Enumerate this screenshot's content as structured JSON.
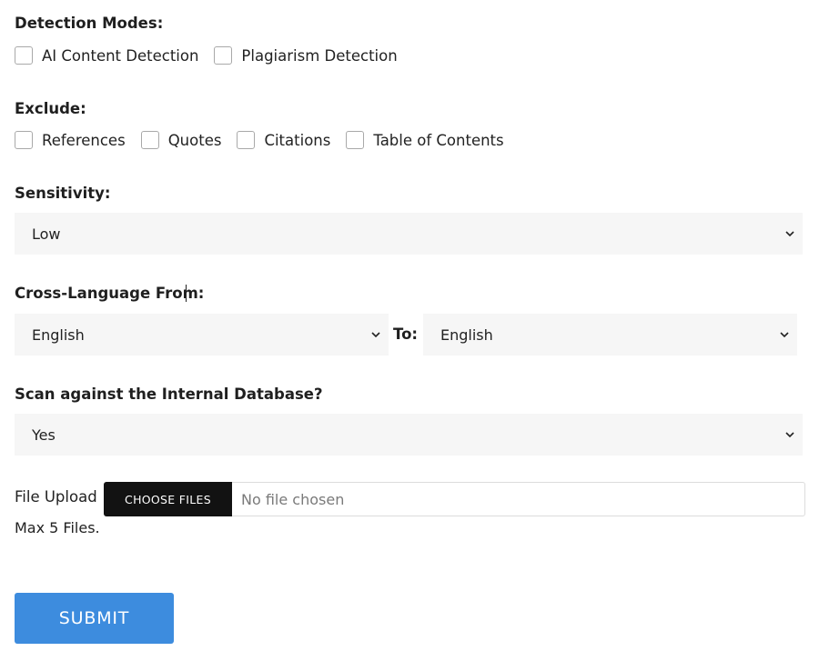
{
  "detection": {
    "heading": "Detection Modes:",
    "options": [
      "AI Content Detection",
      "Plagiarism Detection"
    ]
  },
  "exclude": {
    "heading": "Exclude:",
    "options": [
      "References",
      "Quotes",
      "Citations",
      "Table of Contents"
    ]
  },
  "sensitivity": {
    "heading": "Sensitivity:",
    "value": "Low"
  },
  "cross_language": {
    "heading": "Cross-Language From:",
    "from_value": "English",
    "to_label": "To:",
    "to_value": "English"
  },
  "internal_db": {
    "heading": "Scan against the Internal Database?",
    "value": "Yes"
  },
  "upload": {
    "label": "File Upload",
    "button": "CHOOSE FILES",
    "status": "No file chosen",
    "note": "Max 5 Files."
  },
  "submit": {
    "label": "SUBMIT"
  },
  "icons": {
    "select_arrow": "chevron-down-icon"
  },
  "colors": {
    "submit_bg": "#3d8cde",
    "file_button_bg": "#121212",
    "select_bg": "#f6f6f6"
  }
}
